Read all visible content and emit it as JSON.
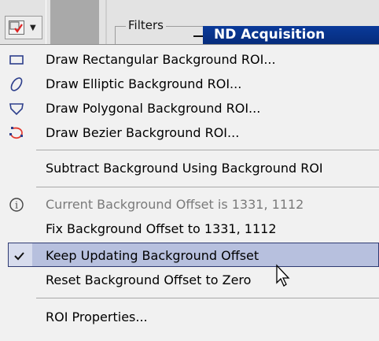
{
  "toolbar": {
    "tool_button_icon": "select-roi-icon",
    "dropdown_icon": "chevron-down-icon",
    "filters_label": "Filters",
    "window_title": "ND Acquisition"
  },
  "menu": {
    "items": [
      {
        "label": "Draw Rectangular Background ROI...",
        "icon": "rectangle-icon"
      },
      {
        "label": "Draw Elliptic Background ROI...",
        "icon": "ellipse-icon"
      },
      {
        "label": "Draw Polygonal Background ROI...",
        "icon": "polygon-icon"
      },
      {
        "label": "Draw Bezier Background ROI...",
        "icon": "bezier-icon"
      },
      {
        "label": "Subtract Background Using Background ROI"
      },
      {
        "label": "Current Background Offset is 1331, 1112",
        "icon": "info-icon",
        "disabled": true
      },
      {
        "label": "Fix Background Offset to 1331, 1112"
      },
      {
        "label": "Keep Updating Background Offset",
        "icon": "check-icon",
        "checked": true,
        "highlighted": true
      },
      {
        "label": "Reset Background Offset to Zero"
      },
      {
        "label": "ROI Properties..."
      }
    ]
  },
  "colors": {
    "highlight": "#b7c0de",
    "title_bar": "#0a3a9a",
    "bezier_icon": "#e33a2f"
  }
}
